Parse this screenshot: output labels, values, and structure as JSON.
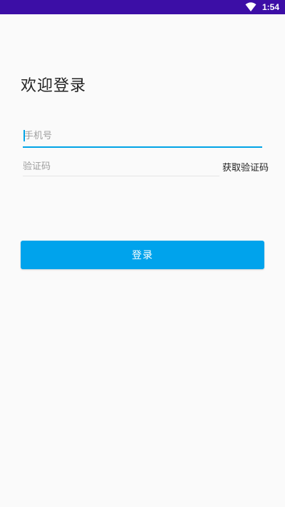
{
  "status_bar": {
    "time": "1:54",
    "wifi_icon": "wifi-icon",
    "background_color": "#3c0ea6"
  },
  "page": {
    "title": "欢迎登录"
  },
  "form": {
    "phone_placeholder": "手机号",
    "phone_value": "",
    "code_placeholder": "验证码",
    "code_value": "",
    "get_code_label": "获取验证码",
    "login_label": "登录"
  },
  "colors": {
    "accent": "#00a3ec",
    "background": "#fafafa"
  }
}
